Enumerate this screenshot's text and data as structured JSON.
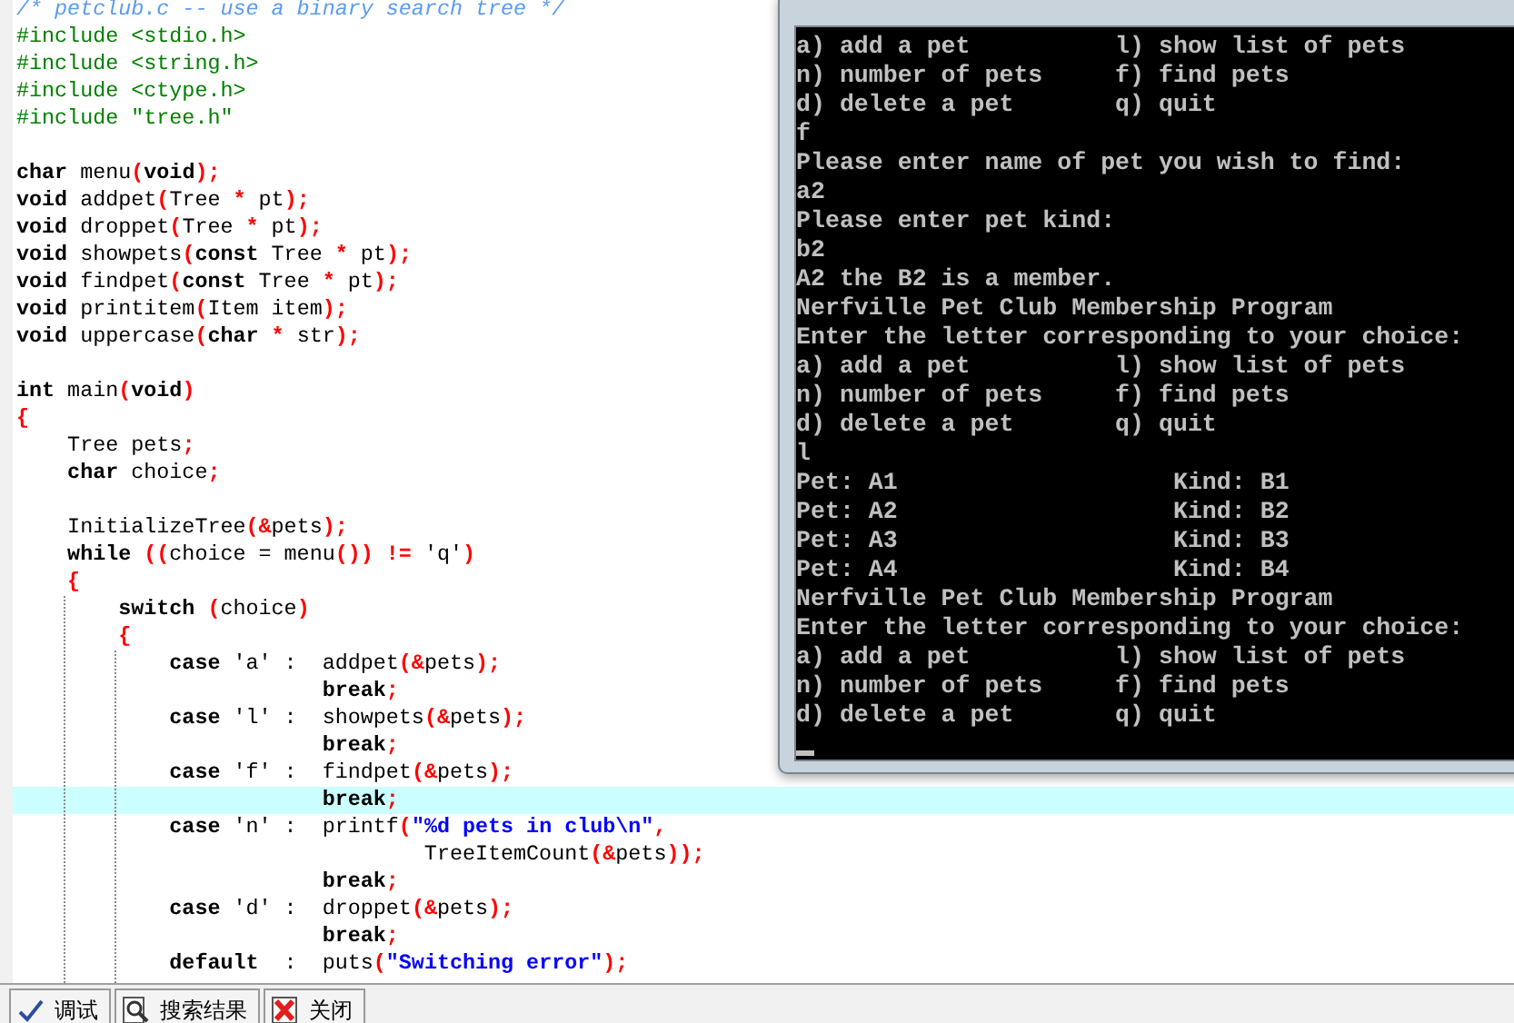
{
  "editor": {
    "lines": [
      {
        "kind": "code",
        "highlighted": false,
        "tokens": [
          {
            "kind": "comment",
            "text": "/* petclub.c -- use a binary search tree */"
          }
        ]
      },
      {
        "kind": "code",
        "highlighted": false,
        "tokens": [
          {
            "kind": "preprocessor",
            "text": "#include <stdio.h>"
          }
        ]
      },
      {
        "kind": "code",
        "highlighted": false,
        "tokens": [
          {
            "kind": "preprocessor",
            "text": "#include <string.h>"
          }
        ]
      },
      {
        "kind": "code",
        "highlighted": false,
        "tokens": [
          {
            "kind": "preprocessor",
            "text": "#include <ctype.h>"
          }
        ]
      },
      {
        "kind": "code",
        "highlighted": false,
        "tokens": [
          {
            "kind": "preprocessor",
            "text": "#include \"tree.h\""
          }
        ]
      },
      {
        "kind": "blank"
      },
      {
        "kind": "code",
        "highlighted": false,
        "tokens": [
          {
            "kind": "keyword",
            "text": "char"
          },
          {
            "kind": "plain",
            "text": " menu"
          },
          {
            "kind": "punct",
            "text": "("
          },
          {
            "kind": "keyword",
            "text": "void"
          },
          {
            "kind": "punct",
            "text": ");"
          }
        ]
      },
      {
        "kind": "code",
        "highlighted": false,
        "tokens": [
          {
            "kind": "keyword",
            "text": "void"
          },
          {
            "kind": "plain",
            "text": " addpet"
          },
          {
            "kind": "punct",
            "text": "("
          },
          {
            "kind": "plain",
            "text": "Tree "
          },
          {
            "kind": "punct",
            "text": "*"
          },
          {
            "kind": "plain",
            "text": " pt"
          },
          {
            "kind": "punct",
            "text": ");"
          }
        ]
      },
      {
        "kind": "code",
        "highlighted": false,
        "tokens": [
          {
            "kind": "keyword",
            "text": "void"
          },
          {
            "kind": "plain",
            "text": " droppet"
          },
          {
            "kind": "punct",
            "text": "("
          },
          {
            "kind": "plain",
            "text": "Tree "
          },
          {
            "kind": "punct",
            "text": "*"
          },
          {
            "kind": "plain",
            "text": " pt"
          },
          {
            "kind": "punct",
            "text": ");"
          }
        ]
      },
      {
        "kind": "code",
        "highlighted": false,
        "tokens": [
          {
            "kind": "keyword",
            "text": "void"
          },
          {
            "kind": "plain",
            "text": " showpets"
          },
          {
            "kind": "punct",
            "text": "("
          },
          {
            "kind": "keyword",
            "text": "const"
          },
          {
            "kind": "plain",
            "text": " Tree "
          },
          {
            "kind": "punct",
            "text": "*"
          },
          {
            "kind": "plain",
            "text": " pt"
          },
          {
            "kind": "punct",
            "text": ");"
          }
        ]
      },
      {
        "kind": "code",
        "highlighted": false,
        "tokens": [
          {
            "kind": "keyword",
            "text": "void"
          },
          {
            "kind": "plain",
            "text": " findpet"
          },
          {
            "kind": "punct",
            "text": "("
          },
          {
            "kind": "keyword",
            "text": "const"
          },
          {
            "kind": "plain",
            "text": " Tree "
          },
          {
            "kind": "punct",
            "text": "*"
          },
          {
            "kind": "plain",
            "text": " pt"
          },
          {
            "kind": "punct",
            "text": ");"
          }
        ]
      },
      {
        "kind": "code",
        "highlighted": false,
        "tokens": [
          {
            "kind": "keyword",
            "text": "void"
          },
          {
            "kind": "plain",
            "text": " printitem"
          },
          {
            "kind": "punct",
            "text": "("
          },
          {
            "kind": "plain",
            "text": "Item item"
          },
          {
            "kind": "punct",
            "text": ");"
          }
        ]
      },
      {
        "kind": "code",
        "highlighted": false,
        "tokens": [
          {
            "kind": "keyword",
            "text": "void"
          },
          {
            "kind": "plain",
            "text": " uppercase"
          },
          {
            "kind": "punct",
            "text": "("
          },
          {
            "kind": "keyword",
            "text": "char"
          },
          {
            "kind": "punct",
            "text": " *"
          },
          {
            "kind": "plain",
            "text": " str"
          },
          {
            "kind": "punct",
            "text": ");"
          }
        ]
      },
      {
        "kind": "blank"
      },
      {
        "kind": "code",
        "highlighted": false,
        "tokens": [
          {
            "kind": "keyword",
            "text": "int"
          },
          {
            "kind": "plain",
            "text": " main"
          },
          {
            "kind": "punct",
            "text": "("
          },
          {
            "kind": "keyword",
            "text": "void"
          },
          {
            "kind": "punct",
            "text": ")"
          }
        ]
      },
      {
        "kind": "code",
        "highlighted": false,
        "tokens": [
          {
            "kind": "punct",
            "text": "{"
          }
        ]
      },
      {
        "kind": "code",
        "highlighted": false,
        "tokens": [
          {
            "kind": "plain",
            "text": "    Tree pets"
          },
          {
            "kind": "punct",
            "text": ";"
          }
        ]
      },
      {
        "kind": "code",
        "highlighted": false,
        "tokens": [
          {
            "kind": "keyword",
            "text": "    char"
          },
          {
            "kind": "plain",
            "text": " choice"
          },
          {
            "kind": "punct",
            "text": ";"
          }
        ]
      },
      {
        "kind": "blank"
      },
      {
        "kind": "code",
        "highlighted": false,
        "tokens": [
          {
            "kind": "plain",
            "text": "    InitializeTree"
          },
          {
            "kind": "punct",
            "text": "(&"
          },
          {
            "kind": "plain",
            "text": "pets"
          },
          {
            "kind": "punct",
            "text": ");"
          }
        ]
      },
      {
        "kind": "code",
        "highlighted": false,
        "tokens": [
          {
            "kind": "keyword",
            "text": "    while"
          },
          {
            "kind": "punct",
            "text": " (("
          },
          {
            "kind": "plain",
            "text": "choice = menu"
          },
          {
            "kind": "punct",
            "text": "()) !="
          },
          {
            "kind": "plain",
            "text": " 'q'"
          },
          {
            "kind": "punct",
            "text": ")"
          }
        ]
      },
      {
        "kind": "code",
        "highlighted": false,
        "tokens": [
          {
            "kind": "punct",
            "text": "    {"
          }
        ]
      },
      {
        "kind": "code",
        "highlighted": false,
        "tokens": [
          {
            "kind": "keyword",
            "text": "        switch"
          },
          {
            "kind": "punct",
            "text": " ("
          },
          {
            "kind": "plain",
            "text": "choice"
          },
          {
            "kind": "punct",
            "text": ")"
          }
        ]
      },
      {
        "kind": "code",
        "highlighted": false,
        "tokens": [
          {
            "kind": "punct",
            "text": "        {"
          }
        ]
      },
      {
        "kind": "code",
        "highlighted": false,
        "tokens": [
          {
            "kind": "keyword",
            "text": "            case"
          },
          {
            "kind": "plain",
            "text": " 'a' :  addpet"
          },
          {
            "kind": "punct",
            "text": "(&"
          },
          {
            "kind": "plain",
            "text": "pets"
          },
          {
            "kind": "punct",
            "text": ");"
          }
        ]
      },
      {
        "kind": "code",
        "highlighted": false,
        "tokens": [
          {
            "kind": "keyword",
            "text": "                        break"
          },
          {
            "kind": "punct",
            "text": ";"
          }
        ]
      },
      {
        "kind": "code",
        "highlighted": false,
        "tokens": [
          {
            "kind": "keyword",
            "text": "            case"
          },
          {
            "kind": "plain",
            "text": " 'l' :  showpets"
          },
          {
            "kind": "punct",
            "text": "(&"
          },
          {
            "kind": "plain",
            "text": "pets"
          },
          {
            "kind": "punct",
            "text": ");"
          }
        ]
      },
      {
        "kind": "code",
        "highlighted": false,
        "tokens": [
          {
            "kind": "keyword",
            "text": "                        break"
          },
          {
            "kind": "punct",
            "text": ";"
          }
        ]
      },
      {
        "kind": "code",
        "highlighted": false,
        "tokens": [
          {
            "kind": "keyword",
            "text": "            case"
          },
          {
            "kind": "plain",
            "text": " 'f' :  findpet"
          },
          {
            "kind": "punct",
            "text": "(&"
          },
          {
            "kind": "plain",
            "text": "pets"
          },
          {
            "kind": "punct",
            "text": ");"
          }
        ]
      },
      {
        "kind": "code",
        "highlighted": true,
        "tokens": [
          {
            "kind": "keyword",
            "text": "                        break"
          },
          {
            "kind": "punct",
            "text": ";"
          }
        ]
      },
      {
        "kind": "code",
        "highlighted": false,
        "tokens": [
          {
            "kind": "keyword",
            "text": "            case"
          },
          {
            "kind": "plain",
            "text": " 'n' :  printf"
          },
          {
            "kind": "punct",
            "text": "("
          },
          {
            "kind": "string",
            "text": "\"%d pets in club\\n\""
          },
          {
            "kind": "punct",
            "text": ","
          }
        ]
      },
      {
        "kind": "code",
        "highlighted": false,
        "tokens": [
          {
            "kind": "plain",
            "text": "                                TreeItemCount"
          },
          {
            "kind": "punct",
            "text": "(&"
          },
          {
            "kind": "plain",
            "text": "pets"
          },
          {
            "kind": "punct",
            "text": "));"
          }
        ]
      },
      {
        "kind": "code",
        "highlighted": false,
        "tokens": [
          {
            "kind": "keyword",
            "text": "                        break"
          },
          {
            "kind": "punct",
            "text": ";"
          }
        ]
      },
      {
        "kind": "code",
        "highlighted": false,
        "tokens": [
          {
            "kind": "keyword",
            "text": "            case"
          },
          {
            "kind": "plain",
            "text": " 'd' :  droppet"
          },
          {
            "kind": "punct",
            "text": "(&"
          },
          {
            "kind": "plain",
            "text": "pets"
          },
          {
            "kind": "punct",
            "text": ");"
          }
        ]
      },
      {
        "kind": "code",
        "highlighted": false,
        "tokens": [
          {
            "kind": "keyword",
            "text": "                        break"
          },
          {
            "kind": "punct",
            "text": ";"
          }
        ]
      },
      {
        "kind": "code",
        "highlighted": false,
        "tokens": [
          {
            "kind": "keyword",
            "text": "            default"
          },
          {
            "kind": "plain",
            "text": "  :  puts"
          },
          {
            "kind": "punct",
            "text": "("
          },
          {
            "kind": "string",
            "text": "\"Switching error\""
          },
          {
            "kind": "punct",
            "text": ");"
          }
        ]
      }
    ]
  },
  "console": {
    "lines": [
      "a) add a pet          l) show list of pets",
      "n) number of pets     f) find pets",
      "d) delete a pet       q) quit",
      "f",
      "Please enter name of pet you wish to find:",
      "a2",
      "Please enter pet kind:",
      "b2",
      "A2 the B2 is a member.",
      "Nerfville Pet Club Membership Program",
      "Enter the letter corresponding to your choice:",
      "a) add a pet          l) show list of pets",
      "n) number of pets     f) find pets",
      "d) delete a pet       q) quit",
      "l",
      "Pet: A1                   Kind: B1",
      "Pet: A2                   Kind: B2",
      "Pet: A3                   Kind: B3",
      "Pet: A4                   Kind: B4",
      "Nerfville Pet Club Membership Program",
      "Enter the letter corresponding to your choice:",
      "a) add a pet          l) show list of pets",
      "n) number of pets     f) find pets",
      "d) delete a pet       q) quit"
    ]
  },
  "bottom_tabs": [
    {
      "label": "调试"
    },
    {
      "label": "搜索结果"
    },
    {
      "label": "关闭"
    }
  ]
}
